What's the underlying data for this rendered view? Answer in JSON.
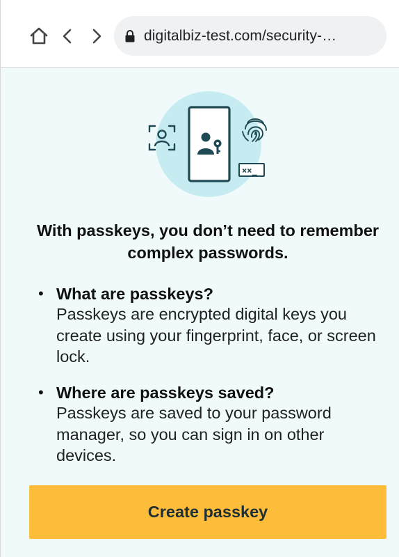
{
  "browser": {
    "url": "digitalbiz-test.com/security-…",
    "icons": {
      "home": "home-icon",
      "back": "chevron-left-icon",
      "forward": "chevron-right-icon",
      "lock": "lock-icon"
    }
  },
  "illustration": {
    "icons": [
      "face-scan-icon",
      "phone-icon",
      "user-key-icon",
      "fingerprint-icon",
      "password-field-icon"
    ],
    "password_mask": "××_",
    "colors": {
      "circle": "#c6ecf2",
      "outline": "#1f4a54"
    }
  },
  "page": {
    "headline": "With passkeys, you don’t need to remember complex passwords.",
    "faqs": [
      {
        "question": "What are passkeys?",
        "answer": "Passkeys are encrypted digital keys you create using your fingerprint, face, or screen lock."
      },
      {
        "question": "Where are passkeys saved?",
        "answer": "Passkeys are saved to your password manager, so you can sign in on other devices."
      }
    ],
    "bullet": "•",
    "cta_label": "Create passkey"
  },
  "colors": {
    "background": "#f0fafb",
    "cta": "#fdbd3a",
    "cta_text": "#1f2f34"
  }
}
